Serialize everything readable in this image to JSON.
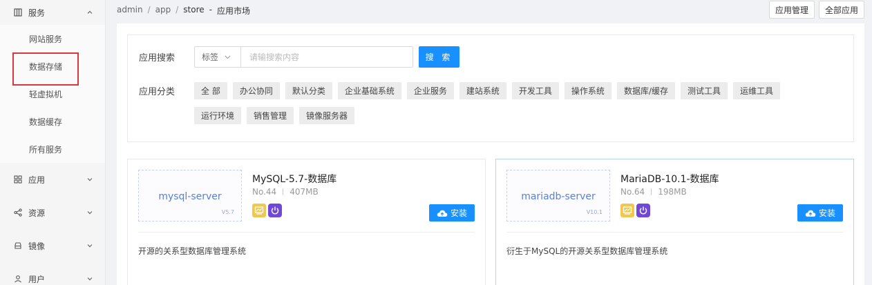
{
  "sidebar": {
    "service": {
      "label": "服务",
      "icon": "grid-icon"
    },
    "service_items": [
      {
        "label": "网站服务"
      },
      {
        "label": "数据存储"
      },
      {
        "label": "轻虚拟机"
      },
      {
        "label": "数据缓存"
      },
      {
        "label": "所有服务"
      }
    ],
    "groups": [
      {
        "label": "应用",
        "icon": "apps-icon"
      },
      {
        "label": "资源",
        "icon": "share-icon"
      },
      {
        "label": "镜像",
        "icon": "disk-icon"
      },
      {
        "label": "用户",
        "icon": "user-icon"
      }
    ]
  },
  "breadcrumb": {
    "p1": "admin",
    "p2": "app",
    "p3": "store",
    "dash": "-",
    "current": "应用市场"
  },
  "topbar": {
    "manage_label": "应用管理",
    "all_label": "全部应用"
  },
  "search": {
    "label": "应用搜索",
    "select_value": "标签",
    "placeholder": "请输搜索内容",
    "button_label": "搜 索"
  },
  "categories": {
    "label": "应用分类",
    "tags": [
      "全 部",
      "办公协同",
      "默认分类",
      "企业基础系统",
      "企业服务",
      "建站系统",
      "开发工具",
      "操作系统",
      "数据库/缓存",
      "测试工具",
      "运维工具",
      "运行环境",
      "销售管理",
      "镜像服务器"
    ]
  },
  "apps": [
    {
      "thumb_name": "mysql-server",
      "thumb_version": "V5.7",
      "title": "MySQL-5.7-数据库",
      "number": "No.44",
      "size": "407MB",
      "install_label": "安装",
      "description": "开源的关系型数据库管理系统"
    },
    {
      "thumb_name": "mariadb-server",
      "thumb_version": "V10.1",
      "title": "MariaDB-10.1-数据库",
      "number": "No.64",
      "size": "198MB",
      "install_label": "安装",
      "description": "衍生于MySQL的开源关系型数据库管理系统"
    }
  ],
  "colors": {
    "primary": "#1890ff",
    "highlight": "#d9363e",
    "icon_yellow": "#f0c850",
    "icon_purple": "#7048d8"
  }
}
